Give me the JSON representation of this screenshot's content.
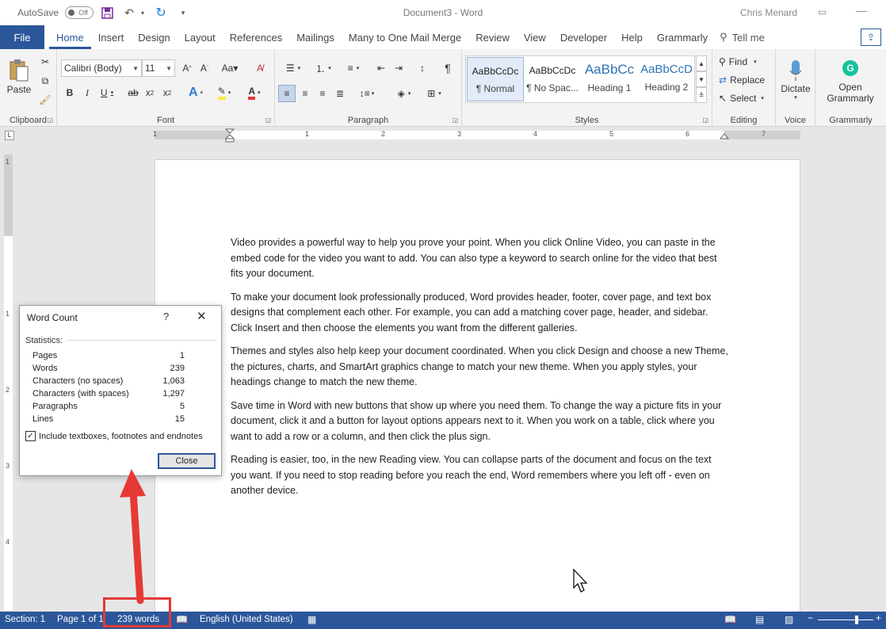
{
  "titlebar": {
    "autosave_label": "AutoSave",
    "autosave_state": "Off",
    "doc_title": "Document3  -  Word",
    "user": "Chris Menard"
  },
  "tabs": {
    "file": "File",
    "items": [
      "Home",
      "Insert",
      "Design",
      "Layout",
      "References",
      "Mailings",
      "Many to One Mail Merge",
      "Review",
      "View",
      "Developer",
      "Help",
      "Grammarly"
    ],
    "active": "Home",
    "tell_me": "Tell me"
  },
  "ribbon": {
    "clipboard": {
      "label": "Clipboard",
      "paste": "Paste"
    },
    "font": {
      "label": "Font",
      "font_name": "Calibri (Body)",
      "font_size": "11"
    },
    "paragraph": {
      "label": "Paragraph"
    },
    "styles": {
      "label": "Styles",
      "items": [
        {
          "sample": "AaBbCcDc",
          "name": "¶ Normal"
        },
        {
          "sample": "AaBbCcDc",
          "name": "¶ No Spac..."
        },
        {
          "sample": "AaBbCc",
          "name": "Heading 1"
        },
        {
          "sample": "AaBbCcD",
          "name": "Heading 2"
        }
      ]
    },
    "editing": {
      "label": "Editing",
      "find": "Find",
      "replace": "Replace",
      "select": "Select"
    },
    "voice": {
      "label": "Voice",
      "dictate": "Dictate"
    },
    "grammarly": {
      "label": "Grammarly",
      "open_line1": "Open",
      "open_line2": "Grammarly"
    }
  },
  "ruler": {
    "numbers": [
      "1",
      "1",
      "2",
      "3",
      "4",
      "5",
      "6",
      "7"
    ],
    "vnumbers": [
      "1",
      "1",
      "2",
      "3",
      "4"
    ]
  },
  "document": {
    "paragraphs": [
      "Video provides a powerful way to help you prove your point. When you click Online Video, you can paste in the embed code for the video you want to add. You can also type a keyword to search online for the video that best fits your document.",
      "To make your document look professionally produced, Word provides header, footer, cover page, and text box designs that complement each other. For example, you can add a matching cover page, header, and sidebar. Click Insert and then choose the elements you want from the different galleries.",
      "Themes and styles also help keep your document coordinated. When you click Design and choose a new Theme, the pictures, charts, and SmartArt graphics change to match your new theme. When you apply styles, your headings change to match the new theme.",
      "Save time in Word with new buttons that show up where you need them. To change the way a picture fits in your document, click it and a button for layout options appears next to it. When you work on a table, click where you want to add a row or a column, and then click the plus sign.",
      "Reading is easier, too, in the new Reading view. You can collapse parts of the document and focus on the text you want. If you need to stop reading before you reach the end, Word remembers where you left off - even on another device."
    ]
  },
  "word_count_dialog": {
    "title": "Word Count",
    "help": "?",
    "statistics_label": "Statistics:",
    "stats": [
      {
        "label": "Pages",
        "value": "1"
      },
      {
        "label": "Words",
        "value": "239"
      },
      {
        "label": "Characters (no spaces)",
        "value": "1,063"
      },
      {
        "label": "Characters (with spaces)",
        "value": "1,297"
      },
      {
        "label": "Paragraphs",
        "value": "5"
      },
      {
        "label": "Lines",
        "value": "15"
      }
    ],
    "include_checkbox_label": "Include textboxes, footnotes and endnotes",
    "include_checked": true,
    "close_button": "Close"
  },
  "statusbar": {
    "section": "Section: 1",
    "page": "Page 1 of 1",
    "words": "239 words",
    "language": "English (United States)"
  },
  "colors": {
    "accent": "#2b579a",
    "annotation": "#e53935"
  }
}
